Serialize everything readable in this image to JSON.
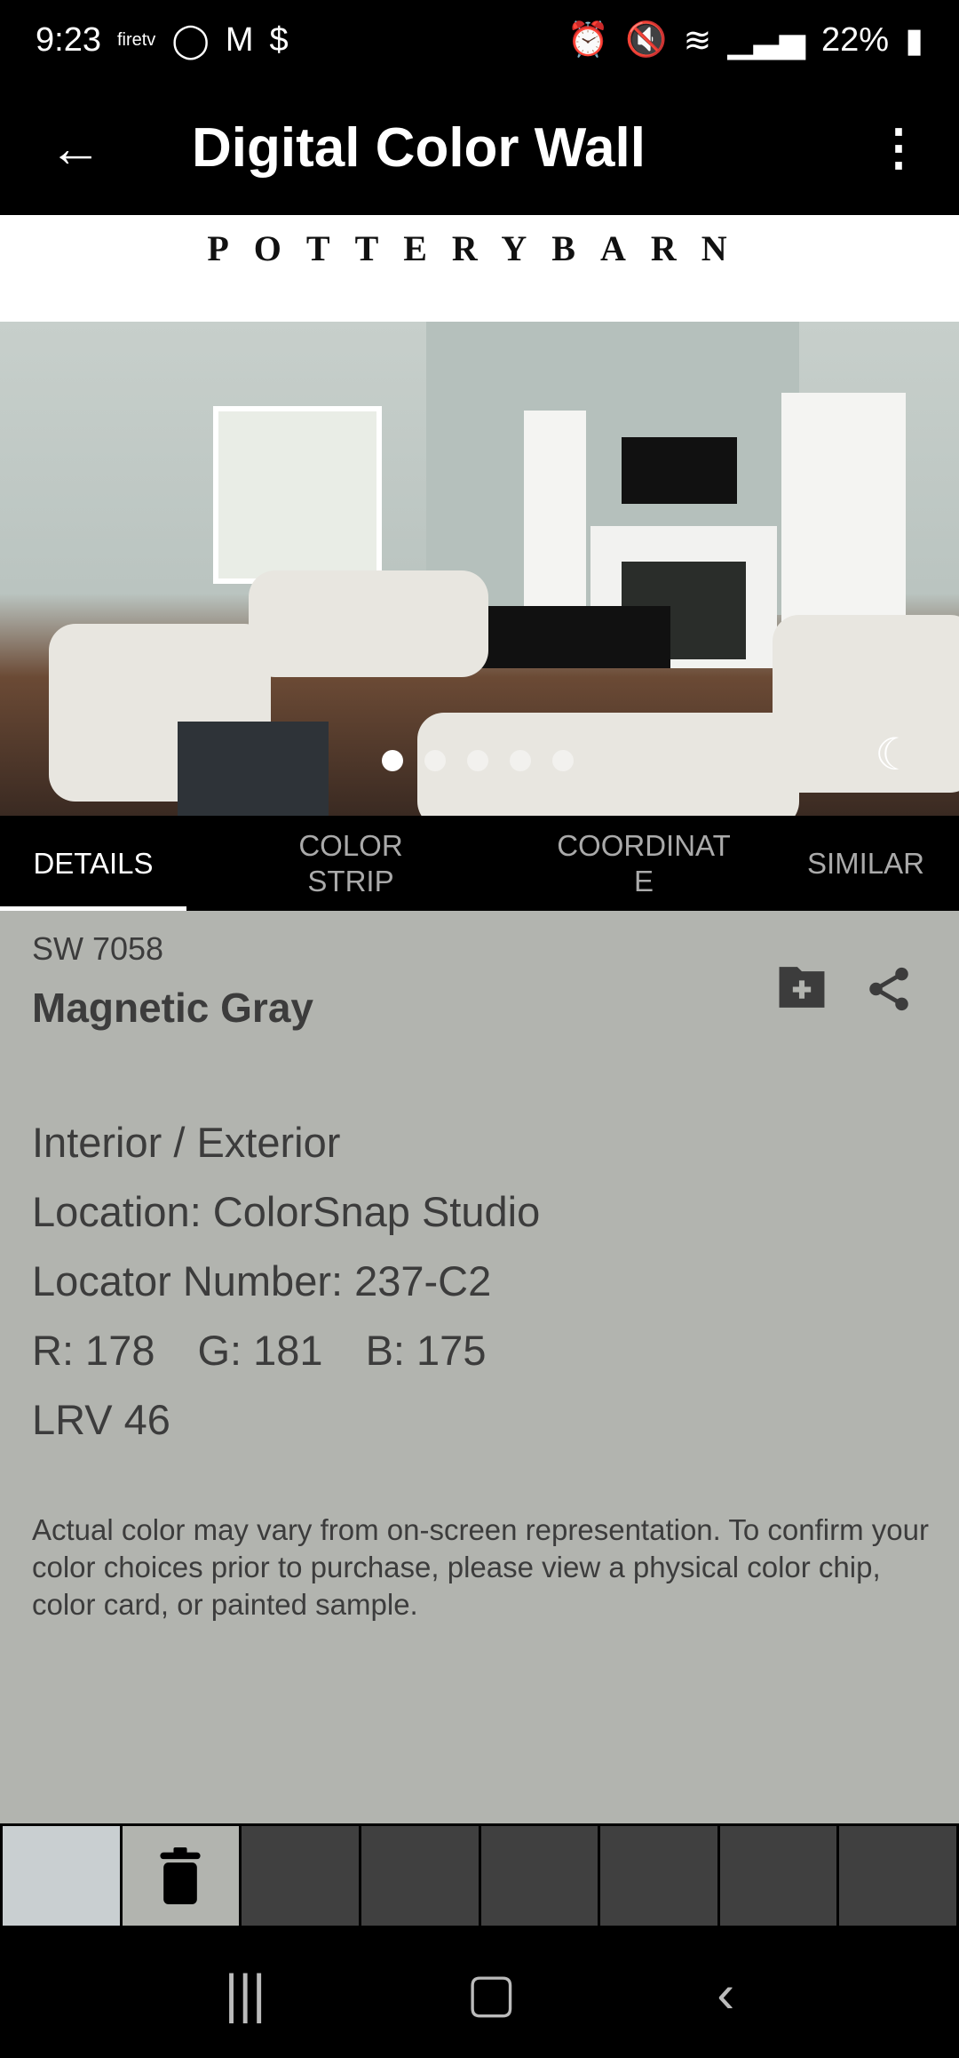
{
  "status": {
    "time": "9:23",
    "notif_icons": [
      "firetv",
      "signal-app",
      "gmail",
      "dollar"
    ],
    "battery": "22%"
  },
  "appbar": {
    "title": "Digital Color Wall"
  },
  "brand": {
    "logo_text": "POTTERY BARN"
  },
  "carousel": {
    "pages": 5,
    "active": 1
  },
  "tabs": [
    {
      "label": "DETAILS",
      "active": true
    },
    {
      "label": "COLOR STRIP"
    },
    {
      "label": "COORDINATE"
    },
    {
      "label": "SIMILAR"
    }
  ],
  "color": {
    "code": "SW 7058",
    "name": "Magnetic Gray",
    "swatch": "#b2b4af",
    "usage": "Interior / Exterior",
    "location": "Location: ColorSnap Studio",
    "locator": "Locator Number: 237-C2",
    "r": "R: 178",
    "g": "G: 181",
    "b": "B: 175",
    "lrv": "LRV 46"
  },
  "disclaimer": "Actual color may vary from on-screen representation. To confirm your color choices prior to purchase, please view a physical color chip, color card, or painted sample.",
  "tray": {
    "current": "#c9cfd1",
    "empty_slots": 6
  }
}
